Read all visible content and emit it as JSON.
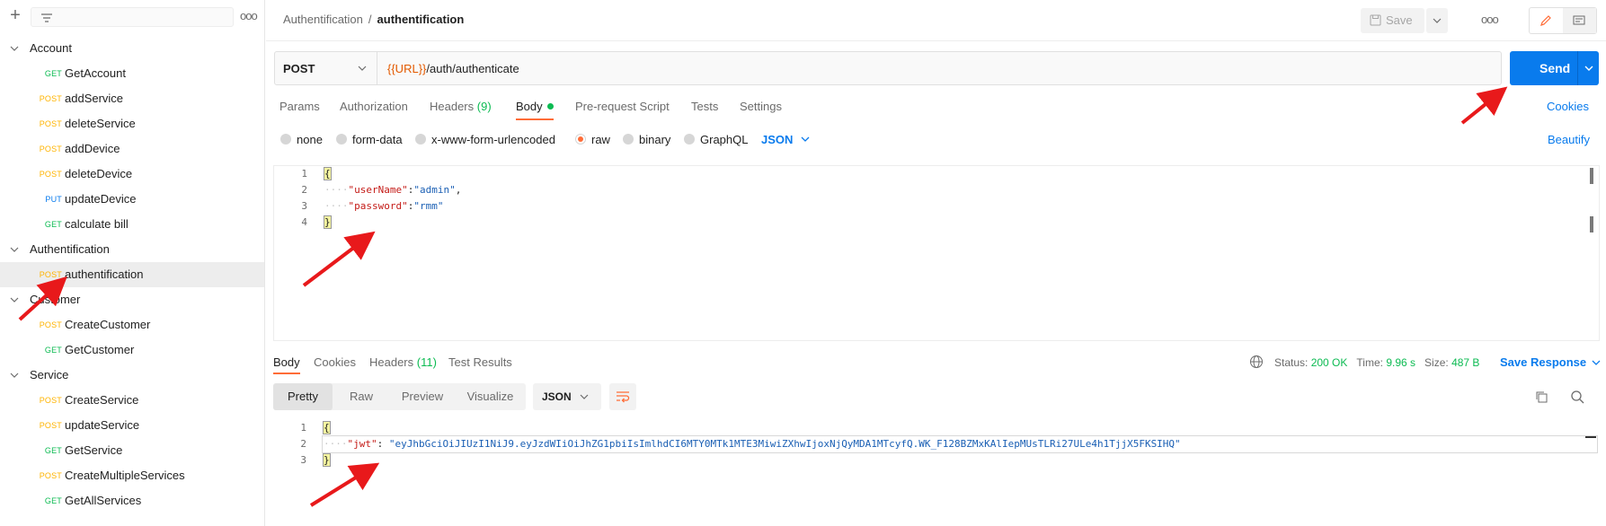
{
  "sidebar": {
    "more_label": "ooo",
    "folders": [
      {
        "name": "Account",
        "requests": [
          {
            "method": "GET",
            "name": "GetAccount"
          },
          {
            "method": "POST",
            "name": "addService"
          },
          {
            "method": "POST",
            "name": "deleteService"
          },
          {
            "method": "POST",
            "name": "addDevice"
          },
          {
            "method": "POST",
            "name": "deleteDevice"
          },
          {
            "method": "PUT",
            "name": "updateDevice"
          },
          {
            "method": "GET",
            "name": "calculate bill"
          }
        ]
      },
      {
        "name": "Authentification",
        "requests": [
          {
            "method": "POST",
            "name": "authentification"
          }
        ]
      },
      {
        "name": "Customer",
        "requests": [
          {
            "method": "POST",
            "name": "CreateCustomer"
          },
          {
            "method": "GET",
            "name": "GetCustomer"
          }
        ]
      },
      {
        "name": "Service",
        "requests": [
          {
            "method": "POST",
            "name": "CreateService"
          },
          {
            "method": "POST",
            "name": "updateService"
          },
          {
            "method": "GET",
            "name": "GetService"
          },
          {
            "method": "POST",
            "name": "CreateMultipleServices"
          },
          {
            "method": "GET",
            "name": "GetAllServices"
          }
        ]
      }
    ]
  },
  "header": {
    "breadcrumb_parent": "Authentification",
    "breadcrumb_sep": "/",
    "breadcrumb_current": "authentification",
    "save_label": "Save",
    "more_label": "ooo"
  },
  "request": {
    "method": "POST",
    "url_var": "{{URL}}",
    "url_path": "/auth/authenticate",
    "send_label": "Send"
  },
  "request_tabs": {
    "params": "Params",
    "authorization": "Authorization",
    "headers": "Headers",
    "headers_count": "(9)",
    "body": "Body",
    "prerequest": "Pre-request Script",
    "tests": "Tests",
    "settings": "Settings",
    "cookies": "Cookies"
  },
  "body_options": {
    "none": "none",
    "form_data": "form-data",
    "urlencoded": "x-www-form-urlencoded",
    "raw": "raw",
    "binary": "binary",
    "graphql": "GraphQL",
    "format": "JSON",
    "beautify": "Beautify"
  },
  "request_body": {
    "line_numbers": [
      "1",
      "2",
      "3",
      "4"
    ],
    "open_brace": "{",
    "close_brace": "}",
    "key1": "\"userName\"",
    "val1": "\"admin\"",
    "key2": "\"password\"",
    "val2": "\"rmm\""
  },
  "response": {
    "tabs": {
      "body": "Body",
      "cookies": "Cookies",
      "headers": "Headers",
      "headers_count": "(11)",
      "test_results": "Test Results"
    },
    "status_label": "Status:",
    "status_value": "200 OK",
    "time_label": "Time:",
    "time_value": "9.96 s",
    "size_label": "Size:",
    "size_value": "487 B",
    "save_response": "Save Response",
    "views": {
      "pretty": "Pretty",
      "raw": "Raw",
      "preview": "Preview",
      "visualize": "Visualize"
    },
    "format": "JSON",
    "line_numbers": [
      "1",
      "2",
      "3"
    ],
    "open_brace": "{",
    "close_brace": "}",
    "jwt_key": "\"jwt\"",
    "jwt_value": "\"eyJhbGciOiJIUzI1NiJ9.eyJzdWIiOiJhZG1pbiIsImlhdCI6MTY0MTk1MTE3MiwiZXhwIjoxNjQyMDA1MTcyfQ.WK_F128BZMxKAlIepMUsTLRi27ULe4h1TjjX5FKSIHQ\""
  },
  "colors": {
    "accent": "#ff6c37",
    "primary": "#097bed",
    "get": "#0cbb52",
    "post": "#ffb400",
    "put": "#097bed",
    "arrow": "#e8191b"
  }
}
